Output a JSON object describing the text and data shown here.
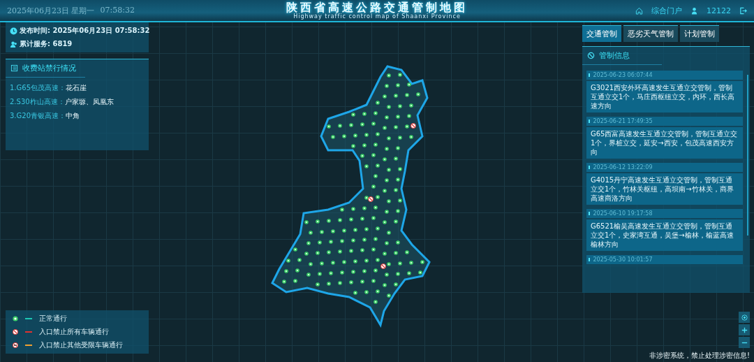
{
  "header": {
    "date": "2025年06月23日 星期一",
    "time": "07:58:32",
    "title": "陕西省高速公路交通管制地图",
    "subtitle": "Highway traffic control map of Shaanxi Province",
    "portal": "综合门户",
    "user": "12122"
  },
  "info": [
    {
      "kind": "clock",
      "label": "发布时间:",
      "value": "2025年06月23日  07:58:32"
    },
    {
      "kind": "people",
      "label": "累计服务:",
      "value": "6819"
    }
  ],
  "closures": {
    "title": "收费站禁行情况",
    "items": [
      {
        "road": "1.G65包茂高速：",
        "stations": "花石崖"
      },
      {
        "road": "2.S30柞山高速：",
        "stations": "户家塬、凤凰东"
      },
      {
        "road": "3.G20青银高速：",
        "stations": "中角"
      }
    ]
  },
  "tabs": [
    {
      "label": "交通管制",
      "selected": true
    },
    {
      "label": "恶劣天气管制",
      "selected": false
    },
    {
      "label": "计划管制",
      "selected": false
    }
  ],
  "control": {
    "title": "管制信息",
    "notices": [
      {
        "time": "2025-06-23 06:07:44",
        "text": "G3021西安外环高速发生互通立交管制，管制互通立交1个，马庄西枢纽立交，内环，西长高速方向"
      },
      {
        "time": "2025-06-21 17:49:35",
        "text": "G65西富高速发生互通立交管制，管制互通立交1个，界桩立交，延安→西安，包茂高速西安方向"
      },
      {
        "time": "2025-06-12 13:22:09",
        "text": "G4015丹宁高速发生互通立交管制，管制互通立交1个，竹林关枢纽，高坝南→竹林关，商界高速商洛方向"
      },
      {
        "time": "2025-06-10 19:17:58",
        "text": "G6521榆吴高速发生互通立交管制，管制互通立交1个，史家湾互通，吴堡→榆林，榆蓝高速榆林方向"
      },
      {
        "time": "2025-05-30 10:01:57"
      }
    ]
  },
  "legend": [
    {
      "kind": "normal",
      "color": "#1ec8b4",
      "label": "正常通行"
    },
    {
      "kind": "closed_all",
      "color": "#e0312f",
      "label": "入口禁止所有车辆通行"
    },
    {
      "kind": "closed_other",
      "color": "#f0a030",
      "label": "入口禁止其他受限车辆通行"
    }
  ],
  "footer": "非涉密系统，禁止处理涉密信息!"
}
